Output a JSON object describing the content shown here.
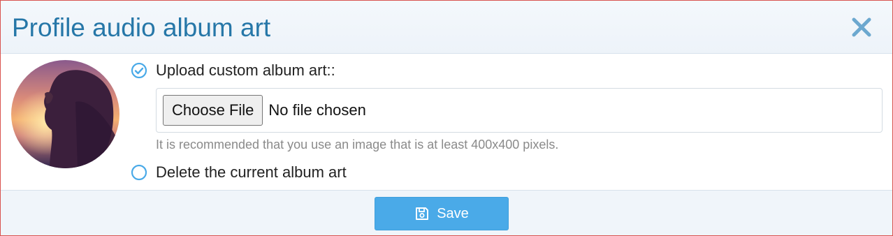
{
  "dialog": {
    "title": "Profile audio album art",
    "close_icon": "close-icon"
  },
  "avatar": {
    "alt": "album art",
    "icon": "album-art-image"
  },
  "options": {
    "upload": {
      "label": "Upload custom album art::",
      "selected": true,
      "icon": "check-circle-icon"
    },
    "delete": {
      "label": "Delete the current album art",
      "selected": false,
      "icon": "radio-empty-icon"
    }
  },
  "file_input": {
    "button_label": "Choose File",
    "status": "No file chosen"
  },
  "help_text": "It is recommended that you use an image that is at least 400x400 pixels.",
  "footer": {
    "save_label": "Save",
    "save_icon": "floppy-disk-icon"
  },
  "colors": {
    "title": "#2677a8",
    "accent": "#4aaae8",
    "close": "#6ca8cf",
    "border": "#d9534f"
  }
}
